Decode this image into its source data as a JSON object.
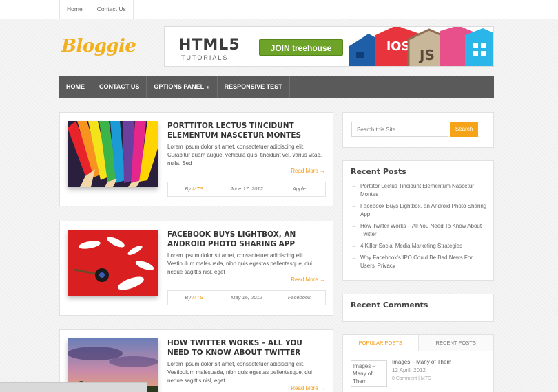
{
  "topnav": {
    "home": "Home",
    "contact": "Contact Us"
  },
  "logo": "Bloggie",
  "banner": {
    "title": "HTML5",
    "subtitle": "TUTORIALS",
    "button": "JOIN treehouse",
    "tile_text_1": "iOS",
    "tile_text_2": "JS"
  },
  "mainnav": {
    "home": "HOME",
    "contact": "CONTACT US",
    "options": "OPTIONS PANEL",
    "options_arrow": "»",
    "responsive": "RESPONSIVE TEST"
  },
  "posts": [
    {
      "title": "PORTTITOR LECTUS TINCIDUNT ELEMENTUM NASCETUR MONTES",
      "excerpt": "Lorem ipsum dolor sit amet, consectetuer adipiscing elit. Curabitur quam augue, vehicula quis, tincidunt vel, varius vitae, nulla. Sed",
      "more": "Read More →",
      "by": "By",
      "author": "MTS",
      "date": "June 17, 2012",
      "category": "Apple"
    },
    {
      "title": "FACEBOOK BUYS LIGHTBOX, AN ANDROID PHOTO SHARING APP",
      "excerpt": "Lorem ipsum dolor sit amet, consectetuer adipiscing elit. Vestibulum malesuada, nibh quis egestas pellentesque, dui neque sagittis nisl, eget",
      "more": "Read More →",
      "by": "By",
      "author": "MTS",
      "date": "May 16, 2012",
      "category": "Facebook"
    },
    {
      "title": "HOW TWITTER WORKS – ALL YOU NEED TO KNOW ABOUT TWITTER",
      "excerpt": "Lorem ipsum dolor sit amet, consectetuer adipiscing elit. Vestibulum malesuada, nibh quis egestas pellentesque, dui neque sagittis nisl, eget",
      "more": "Read More →"
    }
  ],
  "search": {
    "placeholder": "Search this Site...",
    "button": "Search"
  },
  "recent_posts": {
    "title": "Recent Posts",
    "bullet": "→",
    "items": [
      "Porttitor Lectus Tincidunt Elementum Nascetur Montes",
      "Facebook Buys Lightbox, an Android Photo Sharing App",
      "How Twitter Works – All You Need To Know About Twitter",
      "4 Killer Social Media Marketing Strategies",
      "Why Facebook's IPO Could Be Bad News For Users' Privacy"
    ]
  },
  "recent_comments": {
    "title": "Recent Comments"
  },
  "tabs": {
    "popular": "POPULAR POSTS",
    "recent": "RECENT POSTS",
    "item": {
      "thumb_alt": "Images – Many of Them",
      "title": "Images – Many of Them",
      "date": "12 April, 2012",
      "meta": "0 Comment | MTS"
    }
  },
  "colors": {
    "accent": "#f39c12",
    "nav_bg": "#5a5a5a",
    "logo": "#f2b01e",
    "search_button": "#f4a416"
  }
}
